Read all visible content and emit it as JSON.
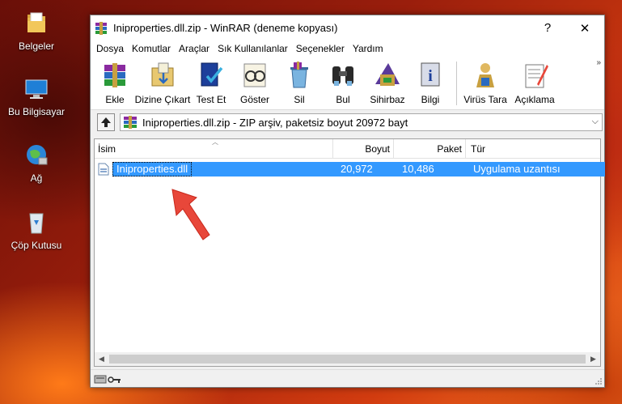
{
  "desktop": {
    "icons": [
      {
        "label": "Belgeler"
      },
      {
        "label": "Bu Bilgisayar"
      },
      {
        "label": "Ağ"
      },
      {
        "label": "Çöp Kutusu"
      }
    ]
  },
  "window": {
    "title": "Iniproperties.dll.zip - WinRAR (deneme kopyası)",
    "help_glyph": "?",
    "close_glyph": "✕"
  },
  "menu": [
    "Dosya",
    "Komutlar",
    "Araçlar",
    "Sık Kullanılanlar",
    "Seçenekler",
    "Yardım"
  ],
  "toolbar": {
    "buttons": [
      {
        "label": "Ekle",
        "icon": "add-icon"
      },
      {
        "label": "Dizine Çıkart",
        "icon": "extract-to-icon"
      },
      {
        "label": "Test Et",
        "icon": "test-icon"
      },
      {
        "label": "Göster",
        "icon": "view-icon"
      },
      {
        "label": "Sil",
        "icon": "delete-icon"
      },
      {
        "label": "Bul",
        "icon": "find-icon"
      },
      {
        "label": "Sihirbaz",
        "icon": "wizard-icon"
      },
      {
        "label": "Bilgi",
        "icon": "info-icon"
      },
      {
        "label": "Virüs Tara",
        "icon": "virus-scan-icon"
      },
      {
        "label": "Açıklama",
        "icon": "comment-icon"
      }
    ],
    "more_glyph": "»"
  },
  "address": {
    "path": "Iniproperties.dll.zip - ZIP arşiv, paketsiz boyut 20972 bayt",
    "dropdown_glyph": "⌵"
  },
  "columns": {
    "name": "İsim",
    "size": "Boyut",
    "packed": "Paket",
    "type": "Tür"
  },
  "files": [
    {
      "name": "Iniproperties.dll",
      "size": "20,972",
      "packed": "10,486",
      "type": "Uygulama uzantısı"
    }
  ],
  "colors": {
    "selection": "#3399ff",
    "arrow": "#e8473a"
  }
}
